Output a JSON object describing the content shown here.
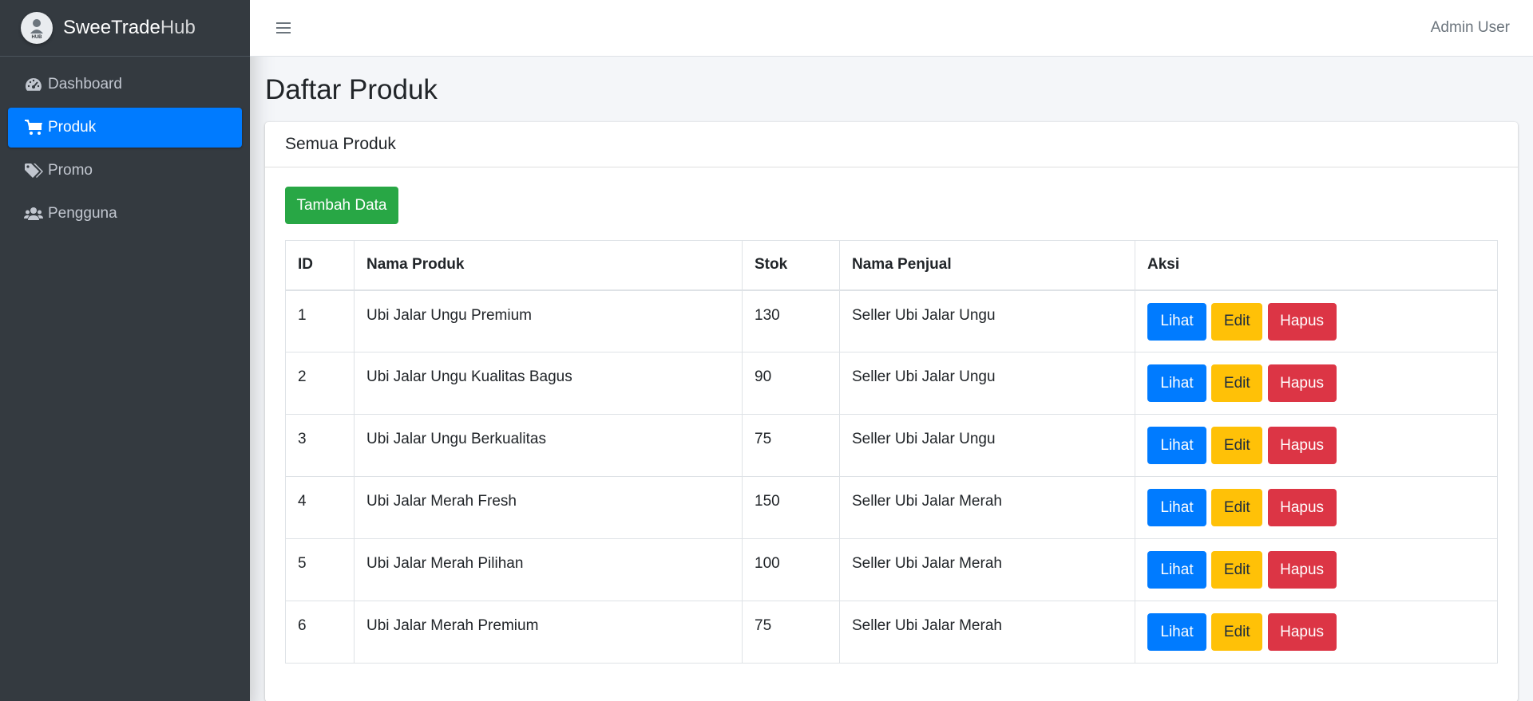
{
  "brand": {
    "name_main": "SweeTrade",
    "name_light": "Hub",
    "logo_text": "HUB"
  },
  "sidebar": {
    "items": [
      {
        "label": "Dashboard",
        "icon": "tachometer-icon",
        "active": false
      },
      {
        "label": "Produk",
        "icon": "cart-icon",
        "active": true
      },
      {
        "label": "Promo",
        "icon": "tags-icon",
        "active": false
      },
      {
        "label": "Pengguna",
        "icon": "users-icon",
        "active": false
      }
    ]
  },
  "header": {
    "menu_icon": "hamburger-icon",
    "user": "Admin User"
  },
  "page": {
    "title": "Daftar Produk"
  },
  "card": {
    "title": "Semua Produk",
    "add_button": "Tambah Data",
    "table": {
      "columns": [
        "ID",
        "Nama Produk",
        "Stok",
        "Nama Penjual",
        "Aksi"
      ],
      "rows": [
        {
          "id": "1",
          "name": "Ubi Jalar Ungu Premium",
          "stok": "130",
          "seller": "Seller Ubi Jalar Ungu"
        },
        {
          "id": "2",
          "name": "Ubi Jalar Ungu Kualitas Bagus",
          "stok": "90",
          "seller": "Seller Ubi Jalar Ungu"
        },
        {
          "id": "3",
          "name": "Ubi Jalar Ungu Berkualitas",
          "stok": "75",
          "seller": "Seller Ubi Jalar Ungu"
        },
        {
          "id": "4",
          "name": "Ubi Jalar Merah Fresh",
          "stok": "150",
          "seller": "Seller Ubi Jalar Merah"
        },
        {
          "id": "5",
          "name": "Ubi Jalar Merah Pilihan",
          "stok": "100",
          "seller": "Seller Ubi Jalar Merah"
        },
        {
          "id": "6",
          "name": "Ubi Jalar Merah Premium",
          "stok": "75",
          "seller": "Seller Ubi Jalar Merah"
        }
      ],
      "actions": {
        "view": "Lihat",
        "edit": "Edit",
        "delete": "Hapus"
      }
    }
  },
  "colors": {
    "sidebar": "#343a40",
    "primary": "#007bff",
    "success": "#28a745",
    "warning": "#ffc107",
    "danger": "#dc3545"
  }
}
